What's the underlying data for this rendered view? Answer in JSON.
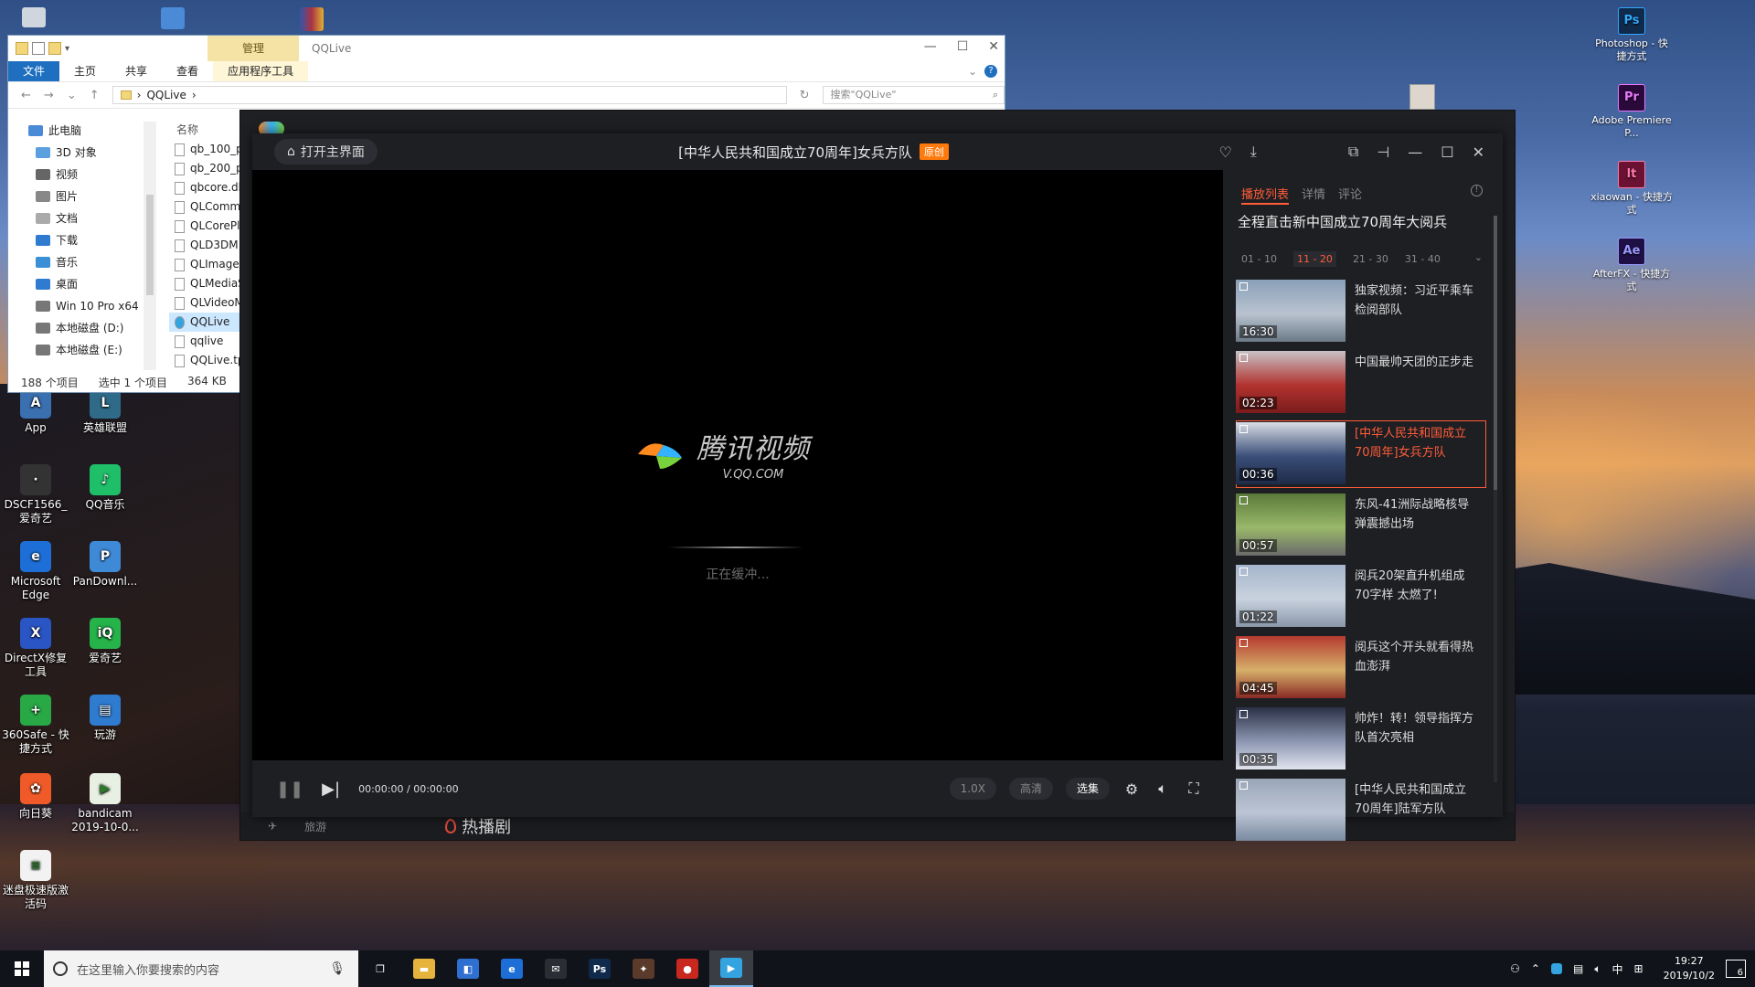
{
  "desktop": {
    "left_icons": [
      {
        "label": "App",
        "color": "#3a6fb0",
        "glyph": "A"
      },
      {
        "label": "英雄联盟",
        "color": "#2f6b88",
        "glyph": "L"
      },
      {
        "label": "DSCF1566_爱奇艺",
        "color": "#333333",
        "glyph": "·"
      },
      {
        "label": "QQ音乐",
        "color": "#1fbf6a",
        "glyph": "♪"
      },
      {
        "label": "Microsoft Edge",
        "color": "#1d6ed6",
        "glyph": "e"
      },
      {
        "label": "PanDownl...",
        "color": "#3f8ad6",
        "glyph": "P"
      },
      {
        "label": "DirectX修复工具",
        "color": "#2a55c5",
        "glyph": "X"
      },
      {
        "label": "爱奇艺",
        "color": "#25b34a",
        "glyph": "iQ"
      },
      {
        "label": "360Safe - 快捷方式",
        "color": "#29a846",
        "glyph": "+"
      },
      {
        "label": "玩游",
        "color": "#2f7bd0",
        "glyph": "▤"
      },
      {
        "label": "向日葵",
        "color": "#f05a28",
        "glyph": "✿"
      },
      {
        "label": "bandicam 2019-10-0...",
        "color": "#e7f0e2",
        "glyph": "▶"
      },
      {
        "label": "迷盘极速版激活码",
        "color": "#f2f2f2",
        "glyph": "≡"
      }
    ],
    "right_icons": [
      {
        "label": "Photoshop - 快捷方式",
        "color": "#0f2a4a",
        "text_color": "#31a8ff",
        "glyph": "Ps"
      },
      {
        "label": "Adobe Premiere P...",
        "color": "#2a0a3a",
        "text_color": "#ea77ff",
        "glyph": "Pr"
      },
      {
        "label": "xiaowan - 快捷方式",
        "color": "#6b1233",
        "text_color": "#ff7aa8",
        "glyph": "lt"
      },
      {
        "label": "AfterFX - 快捷方式",
        "color": "#1e1045",
        "text_color": "#9999ff",
        "glyph": "Ae"
      }
    ]
  },
  "explorer": {
    "manage_tab": "管理",
    "title": "QQLive",
    "ribbon_tabs": [
      "文件",
      "主页",
      "共享",
      "查看",
      "应用程序工具"
    ],
    "address": "QQLive",
    "search_placeholder": "搜索\"QQLive\"",
    "nav_items": [
      {
        "label": "此电脑",
        "color": "#4a8ad6"
      },
      {
        "label": "3D 对象",
        "color": "#5aa0e0"
      },
      {
        "label": "视频",
        "color": "#666666"
      },
      {
        "label": "图片",
        "color": "#888888"
      },
      {
        "label": "文档",
        "color": "#aaaaaa"
      },
      {
        "label": "下载",
        "color": "#2f7bd0"
      },
      {
        "label": "音乐",
        "color": "#3a8fd6"
      },
      {
        "label": "桌面",
        "color": "#2f7bd0"
      },
      {
        "label": "Win 10 Pro x64",
        "color": "#777777"
      },
      {
        "label": "本地磁盘 (D:)",
        "color": "#777777"
      },
      {
        "label": "本地磁盘 (E:)",
        "color": "#777777"
      }
    ],
    "column_header": "名称",
    "files": [
      "qb_100_p",
      "qb_200_p",
      "qbcore.dl",
      "QLComm",
      "QLCorePl",
      "QLD3DM",
      "QLImageF",
      "QLMediaS",
      "QLVideoM",
      "QQLive",
      "qqlive",
      "QQLive.tp"
    ],
    "selected_file": "QQLive",
    "status": {
      "count": "188 个项目",
      "selected": "选中 1 个项目",
      "size": "364 KB"
    }
  },
  "qqlive_main": {
    "bottom_item": "旅游",
    "hot_label": "热播剧"
  },
  "player": {
    "home_button": "打开主界面",
    "title": "[中华人民共和国成立70周年]女兵方队",
    "badge": "原创",
    "logo_brand": "腾讯视频",
    "logo_url": "V.QQ.COM",
    "buffering_text": "正在缓冲...",
    "time": "00:00:00 / 00:00:00",
    "speed": "1.0X",
    "quality": "高清",
    "episodes_button": "选集"
  },
  "panel": {
    "tabs": [
      "播放列表",
      "详情",
      "评论"
    ],
    "title": "全程直击新中国成立70周年大阅兵",
    "ranges": [
      "01 - 10",
      "11 - 20",
      "21 - 30",
      "31 - 40"
    ],
    "active_range": "11 - 20",
    "episodes": [
      {
        "title": "独家视频：习近平乘车检阅部队",
        "duration": "16:30",
        "colors": [
          "#8aa0b8",
          "#b9c3cf",
          "#6b7a88"
        ]
      },
      {
        "title": "中国最帅天团的正步走",
        "duration": "02:23",
        "colors": [
          "#c7c2c6",
          "#b2332f",
          "#7a1c1c"
        ]
      },
      {
        "title": "[中华人民共和国成立70周年]女兵方队",
        "duration": "00:36",
        "colors": [
          "#d9dde5",
          "#3a4e78",
          "#1e2b48"
        ]
      },
      {
        "title": "东风-41洲际战略核导弹震撼出场",
        "duration": "00:57",
        "colors": [
          "#5a7a3a",
          "#9ab86a",
          "#6a6a6a"
        ]
      },
      {
        "title": "阅兵20架直升机组成70字样 太燃了!",
        "duration": "01:22",
        "colors": [
          "#a6b6cc",
          "#c9d2de",
          "#8a98aa"
        ]
      },
      {
        "title": "阅兵这个开头就看得热血澎湃",
        "duration": "04:45",
        "colors": [
          "#b53a30",
          "#d6b06a",
          "#8a2a25"
        ]
      },
      {
        "title": "帅炸！转！领导指挥方队首次亮相",
        "duration": "00:35",
        "colors": [
          "#2a3046",
          "#8d97b2",
          "#e0e4ee"
        ]
      },
      {
        "title": "[中华人民共和国成立70周年]陆军方队",
        "duration": "",
        "colors": [
          "#9aa6b8",
          "#bcc5d4",
          "#7a8aa0"
        ]
      }
    ]
  },
  "taskbar": {
    "search_placeholder": "在这里输入你要搜索的内容",
    "apps": [
      {
        "name": "task-view",
        "color": "#101319",
        "glyph": "❐"
      },
      {
        "name": "file-explorer",
        "color": "#e6b43c",
        "glyph": "▬"
      },
      {
        "name": "store",
        "color": "#2f6fd0",
        "glyph": "◧"
      },
      {
        "name": "edge",
        "color": "#1d6ed6",
        "glyph": "e"
      },
      {
        "name": "mail",
        "color": "#2a2d33",
        "glyph": "✉"
      },
      {
        "name": "photoshop",
        "color": "#0f2a4a",
        "glyph": "Ps"
      },
      {
        "name": "game",
        "color": "#5a3a2a",
        "glyph": "✦"
      },
      {
        "name": "recorder",
        "color": "#c8281e",
        "glyph": "●"
      },
      {
        "name": "qqlive",
        "color": "#33a4e0",
        "glyph": "▶"
      }
    ],
    "ime": "中",
    "time": "19:27",
    "date": "2019/10/2",
    "notifications": "6"
  }
}
